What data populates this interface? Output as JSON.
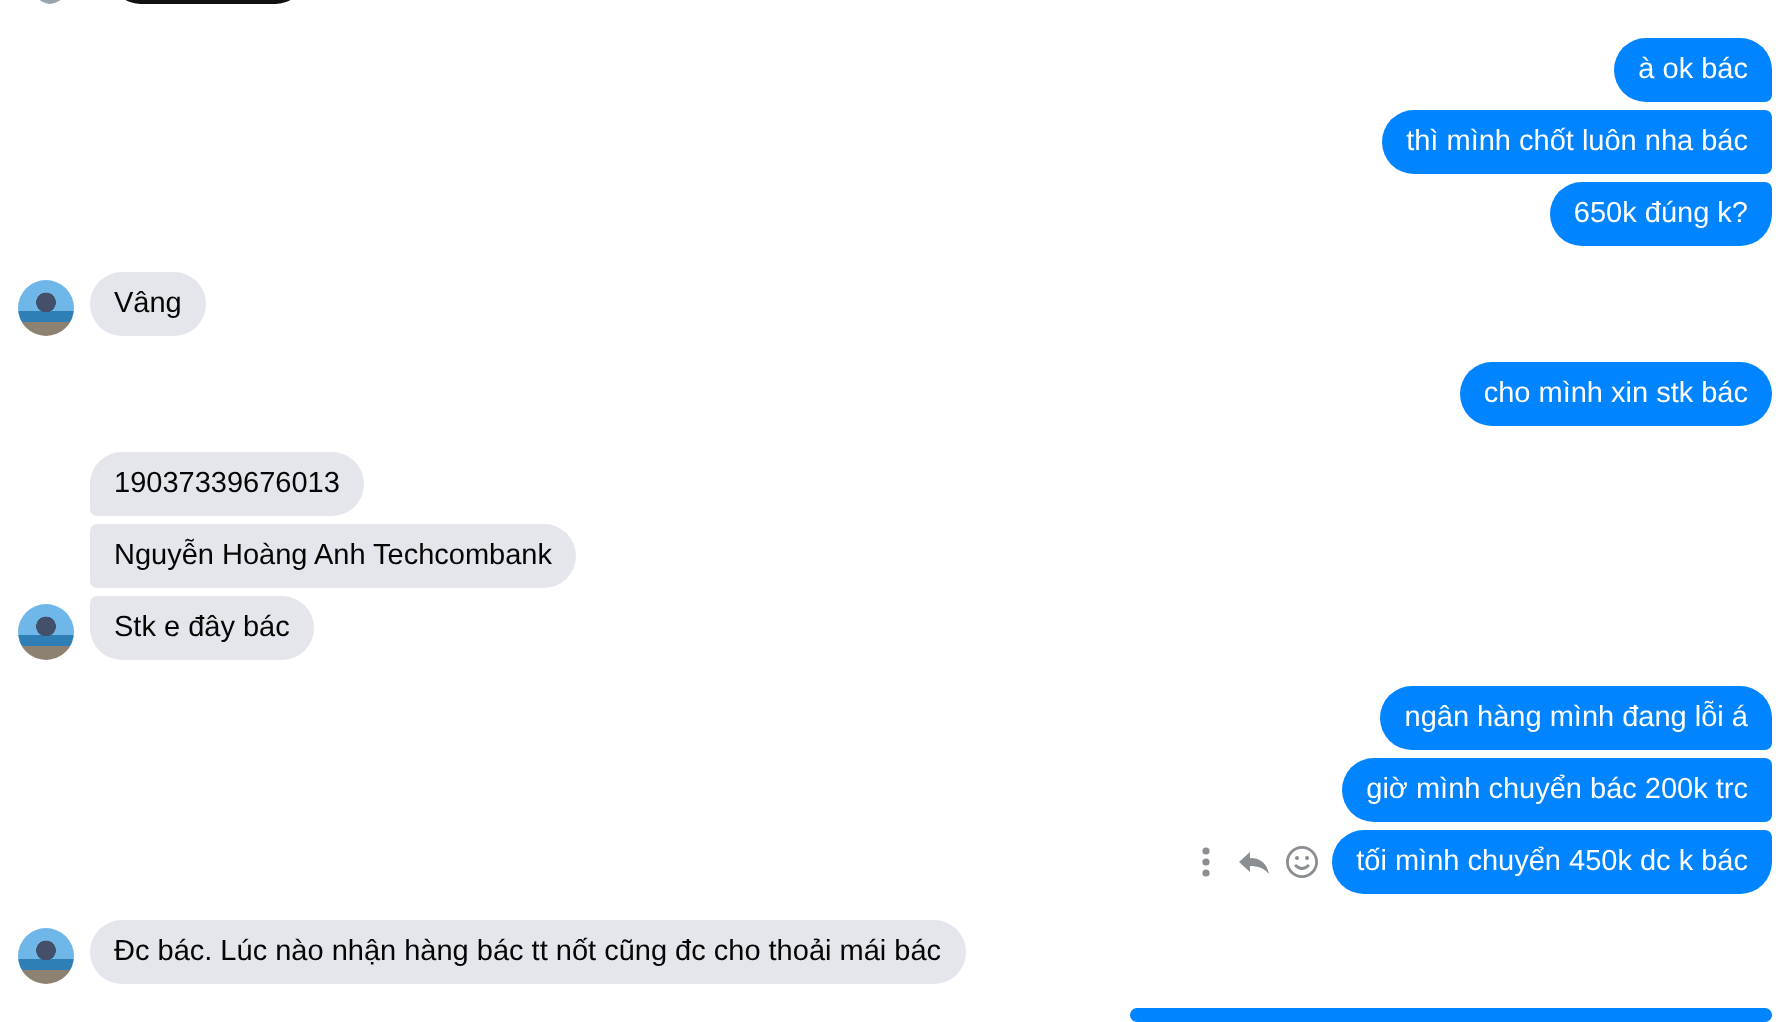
{
  "groups": [
    {
      "kind": "outgoing",
      "messages": [
        {
          "text": "à ok bác",
          "hovered": false
        },
        {
          "text": "thì mình chốt luôn nha bác",
          "hovered": false
        },
        {
          "text": "650k đúng k?",
          "hovered": false
        }
      ]
    },
    {
      "kind": "incoming",
      "messages": [
        {
          "text": "Vâng",
          "hovered": false
        }
      ]
    },
    {
      "kind": "outgoing",
      "messages": [
        {
          "text": "cho mình xin stk bác",
          "hovered": false
        }
      ]
    },
    {
      "kind": "incoming",
      "messages": [
        {
          "text": "19037339676013",
          "hovered": false
        },
        {
          "text": "Nguyễn Hoàng Anh Techcombank",
          "hovered": false
        },
        {
          "text": "Stk e đây bác",
          "hovered": false
        }
      ]
    },
    {
      "kind": "outgoing",
      "messages": [
        {
          "text": "ngân hàng mình đang lỗi á",
          "hovered": false
        },
        {
          "text": "giờ mình chuyển bác 200k trc",
          "hovered": false
        },
        {
          "text": "tối mình chuyển 450k dc k bác",
          "hovered": true
        }
      ]
    },
    {
      "kind": "incoming",
      "messages": [
        {
          "text": "Đc bác. Lúc nào nhận hàng bác tt nốt cũng đc cho thoải mái bác",
          "hovered": false
        }
      ]
    }
  ]
}
